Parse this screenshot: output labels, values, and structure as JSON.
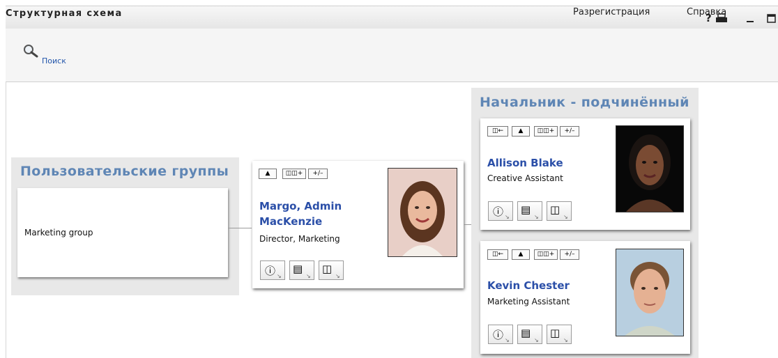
{
  "header": {
    "title": "Структурная схема",
    "logout_label": "Разрегистрация",
    "help_label": "Справка"
  },
  "search": {
    "label": "Поиск"
  },
  "groups": {
    "section_title": "Пользовательские группы",
    "items": [
      {
        "name": "Marketing group"
      }
    ]
  },
  "focus_person": {
    "name_line1": "Margo, Admin",
    "name_line2": "MacKenzie",
    "title": "Director, Marketing"
  },
  "reports": {
    "section_title": "Начальник - подчинённый",
    "people": [
      {
        "name": "Allison Blake",
        "title": "Creative Assistant"
      },
      {
        "name": "Kevin Chester",
        "title": "Marketing Assistant"
      }
    ]
  },
  "toolbar_icons": [
    "go-to-manager-icon",
    "up-arrow-icon",
    "expand-org-icon",
    "toggle-expand-icon"
  ],
  "action_icons": [
    "info-icon",
    "email-icon",
    "org-chart-icon"
  ],
  "colors": {
    "accent_title": "#5f86b5",
    "person_name": "#2b4fa8",
    "panel_bg": "#e8e8e8"
  }
}
